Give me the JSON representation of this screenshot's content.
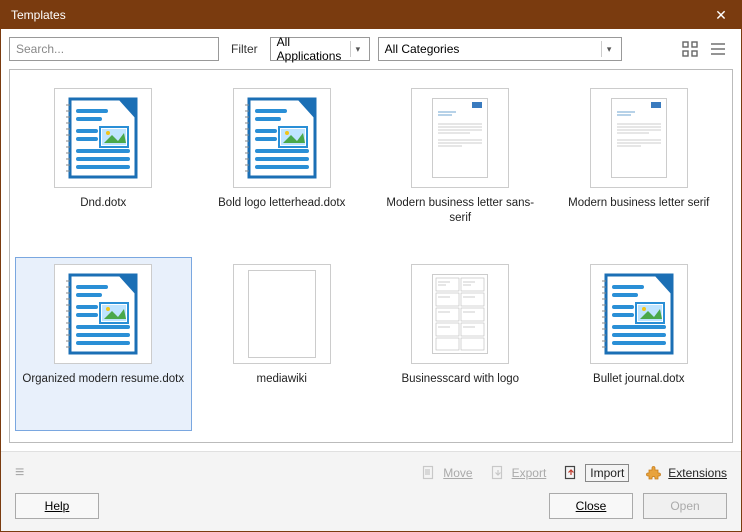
{
  "window": {
    "title": "Templates"
  },
  "toolbar": {
    "search_placeholder": "Search...",
    "filter_label": "Filter",
    "app_select": "All Applications",
    "cat_select": "All Categories"
  },
  "templates": [
    {
      "label": "Dnd.dotx",
      "thumb": "doc"
    },
    {
      "label": "Bold logo letterhead.dotx",
      "thumb": "doc"
    },
    {
      "label": "Modern business letter sans-serif",
      "thumb": "page_simple"
    },
    {
      "label": "Modern business letter serif",
      "thumb": "page_simple"
    },
    {
      "label": "Organized modern resume.dotx",
      "thumb": "doc",
      "selected": true
    },
    {
      "label": "mediawiki",
      "thumb": "blank"
    },
    {
      "label": "Businesscard with logo",
      "thumb": "page_cards"
    },
    {
      "label": "Bullet journal.dotx",
      "thumb": "doc"
    }
  ],
  "footer": {
    "move": "Move",
    "export": "Export",
    "import": "Import",
    "extensions": "Extensions",
    "help": "Help",
    "close": "Close",
    "open": "Open"
  }
}
